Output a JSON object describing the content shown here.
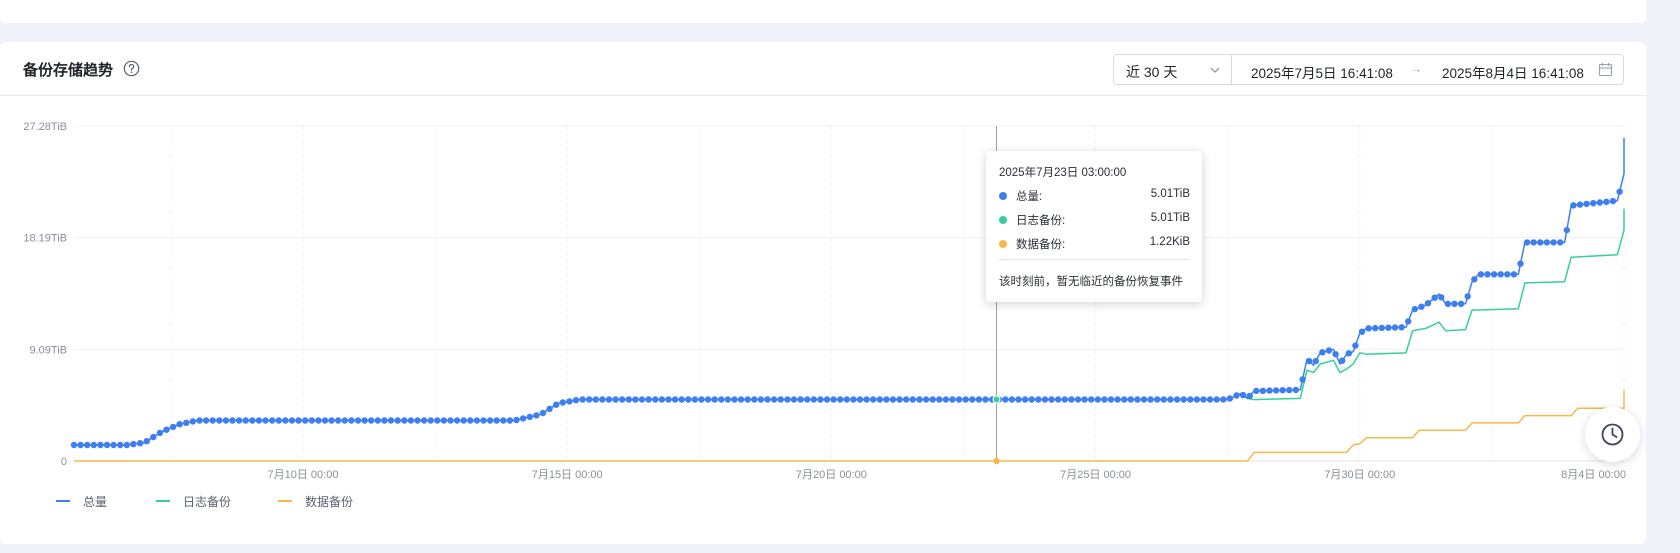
{
  "header": {
    "title": "备份存储趋势",
    "range_select": "近 30 天",
    "start_date": "2025年7月5日 16:41:08",
    "separator": "→",
    "end_date": "2025年8月4日 16:41:08"
  },
  "icons": {
    "help": "question-circle-icon",
    "select": "chevron-down-icon",
    "calendar": "calendar-icon",
    "fab": "clock-icon"
  },
  "colors": {
    "total": "#3d7ff0",
    "log": "#36cf9a",
    "data": "#f7b84a",
    "grid": "#eef0f4"
  },
  "chart_data": {
    "type": "line",
    "x_start": "2025-07-05 16:00",
    "x_end": "2025-08-04 00:00",
    "ylim": [
      0,
      27.28
    ],
    "yunit": "TiB",
    "y_ticks": [
      "0",
      "9.09TiB",
      "18.19TiB",
      "27.28TiB"
    ],
    "x_ticks": [
      "7月10日 00:00",
      "7月15日 00:00",
      "7月20日 00:00",
      "7月25日 00:00",
      "7月30日 00:00",
      "8月4日 00:00"
    ],
    "grid": true,
    "legend": "bottom-left",
    "series": [
      {
        "name": "总量",
        "points": [
          [
            "07-05 16:00",
            1.3
          ],
          [
            "07-06 16:00",
            1.3
          ],
          [
            "07-07 00:00",
            1.5
          ],
          [
            "07-07 08:00",
            2.4
          ],
          [
            "07-07 16:00",
            3.0
          ],
          [
            "07-08 00:00",
            3.3
          ],
          [
            "07-09 00:00",
            3.3
          ],
          [
            "07-14 00:00",
            3.3
          ],
          [
            "07-14 12:00",
            3.8
          ],
          [
            "07-14 20:00",
            4.7
          ],
          [
            "07-15 06:00",
            5.01
          ],
          [
            "07-27 12:00",
            5.01
          ],
          [
            "07-27 18:00",
            5.5
          ],
          [
            "07-27 21:00",
            5.1
          ],
          [
            "07-28 00:00",
            5.7
          ],
          [
            "07-28 21:00",
            5.8
          ],
          [
            "07-29 00:00",
            8.3
          ],
          [
            "07-29 03:00",
            7.8
          ],
          [
            "07-29 06:00",
            8.8
          ],
          [
            "07-29 12:00",
            9.1
          ],
          [
            "07-29 15:00",
            7.9
          ],
          [
            "07-29 18:00",
            8.7
          ],
          [
            "07-29 21:00",
            8.9
          ],
          [
            "07-30 00:00",
            10.4
          ],
          [
            "07-30 03:00",
            10.8
          ],
          [
            "07-30 21:00",
            10.9
          ],
          [
            "07-31 00:00",
            12.3
          ],
          [
            "07-31 06:00",
            12.7
          ],
          [
            "07-31 12:00",
            13.6
          ],
          [
            "07-31 15:00",
            12.8
          ],
          [
            "08-01 00:00",
            12.8
          ],
          [
            "08-01 03:00",
            14.6
          ],
          [
            "08-01 06:00",
            15.2
          ],
          [
            "08-02 00:00",
            15.2
          ],
          [
            "08-02 03:00",
            17.8
          ],
          [
            "08-02 21:00",
            17.8
          ],
          [
            "08-03 00:00",
            20.8
          ],
          [
            "08-03 21:00",
            21.2
          ],
          [
            "08-04 00:00",
            23.4
          ],
          [
            "08-04 21:00",
            23.6
          ],
          [
            "08-05 00:00",
            26.2
          ],
          [
            "08-05 03:00",
            26.3
          ],
          [
            "08-05 21:00",
            26.3
          ]
        ]
      },
      {
        "name": "日志备份",
        "points": [
          [
            "07-05 16:00",
            1.3
          ],
          [
            "07-06 16:00",
            1.3
          ],
          [
            "07-07 00:00",
            1.5
          ],
          [
            "07-07 08:00",
            2.4
          ],
          [
            "07-07 16:00",
            3.0
          ],
          [
            "07-08 00:00",
            3.3
          ],
          [
            "07-09 00:00",
            3.3
          ],
          [
            "07-14 00:00",
            3.3
          ],
          [
            "07-14 12:00",
            3.8
          ],
          [
            "07-14 20:00",
            4.7
          ],
          [
            "07-15 06:00",
            5.01
          ],
          [
            "07-27 12:00",
            5.01
          ],
          [
            "07-27 18:00",
            5.5
          ],
          [
            "07-27 21:00",
            5.1
          ],
          [
            "07-28 00:00",
            5.0
          ],
          [
            "07-28 21:00",
            5.1
          ],
          [
            "07-29 00:00",
            7.4
          ],
          [
            "07-29 03:00",
            7.2
          ],
          [
            "07-29 06:00",
            7.9
          ],
          [
            "07-29 12:00",
            8.2
          ],
          [
            "07-29 15:00",
            7.2
          ],
          [
            "07-29 18:00",
            7.5
          ],
          [
            "07-29 21:00",
            7.9
          ],
          [
            "07-30 00:00",
            8.8
          ],
          [
            "07-30 03:00",
            8.7
          ],
          [
            "07-30 21:00",
            8.8
          ],
          [
            "07-31 00:00",
            10.6
          ],
          [
            "07-31 06:00",
            10.8
          ],
          [
            "07-31 12:00",
            11.3
          ],
          [
            "07-31 15:00",
            10.6
          ],
          [
            "08-01 00:00",
            10.7
          ],
          [
            "08-01 03:00",
            12.3
          ],
          [
            "08-01 06:00",
            12.3
          ],
          [
            "08-02 00:00",
            12.4
          ],
          [
            "08-02 03:00",
            14.5
          ],
          [
            "08-02 21:00",
            14.6
          ],
          [
            "08-03 00:00",
            16.6
          ],
          [
            "08-03 21:00",
            16.8
          ],
          [
            "08-04 00:00",
            18.8
          ],
          [
            "08-04 21:00",
            18.8
          ],
          [
            "08-05 00:00",
            20.5
          ],
          [
            "08-05 03:00",
            20.3
          ],
          [
            "08-05 21:00",
            20.3
          ]
        ]
      },
      {
        "name": "数据备份",
        "points": [
          [
            "07-05 16:00",
            0
          ],
          [
            "07-27 21:00",
            0
          ],
          [
            "07-28 00:00",
            0.7
          ],
          [
            "07-29 18:00",
            0.7
          ],
          [
            "07-29 21:00",
            1.3
          ],
          [
            "07-30 00:00",
            1.4
          ],
          [
            "07-30 03:00",
            1.9
          ],
          [
            "07-31 00:00",
            1.9
          ],
          [
            "07-31 03:00",
            2.5
          ],
          [
            "08-01 00:00",
            2.5
          ],
          [
            "08-01 03:00",
            3.1
          ],
          [
            "08-02 00:00",
            3.1
          ],
          [
            "08-02 03:00",
            3.7
          ],
          [
            "08-03 00:00",
            3.7
          ],
          [
            "08-03 03:00",
            4.3
          ],
          [
            "08-04 00:00",
            4.3
          ],
          [
            "08-04 03:00",
            5.0
          ],
          [
            "08-05 00:00",
            5.0
          ],
          [
            "08-05 03:00",
            5.8
          ],
          [
            "08-05 21:00",
            5.8
          ]
        ]
      }
    ],
    "markers": "dot",
    "highlight_time": "07-23 03:00"
  },
  "tooltip": {
    "time": "2025年7月23日 03:00:00",
    "rows": [
      {
        "name": "总量:",
        "value": "5.01TiB"
      },
      {
        "name": "日志备份:",
        "value": "5.01TiB"
      },
      {
        "name": "数据备份:",
        "value": "1.22KiB"
      }
    ],
    "note": "该时刻前，暂无临近的备份恢复事件"
  }
}
